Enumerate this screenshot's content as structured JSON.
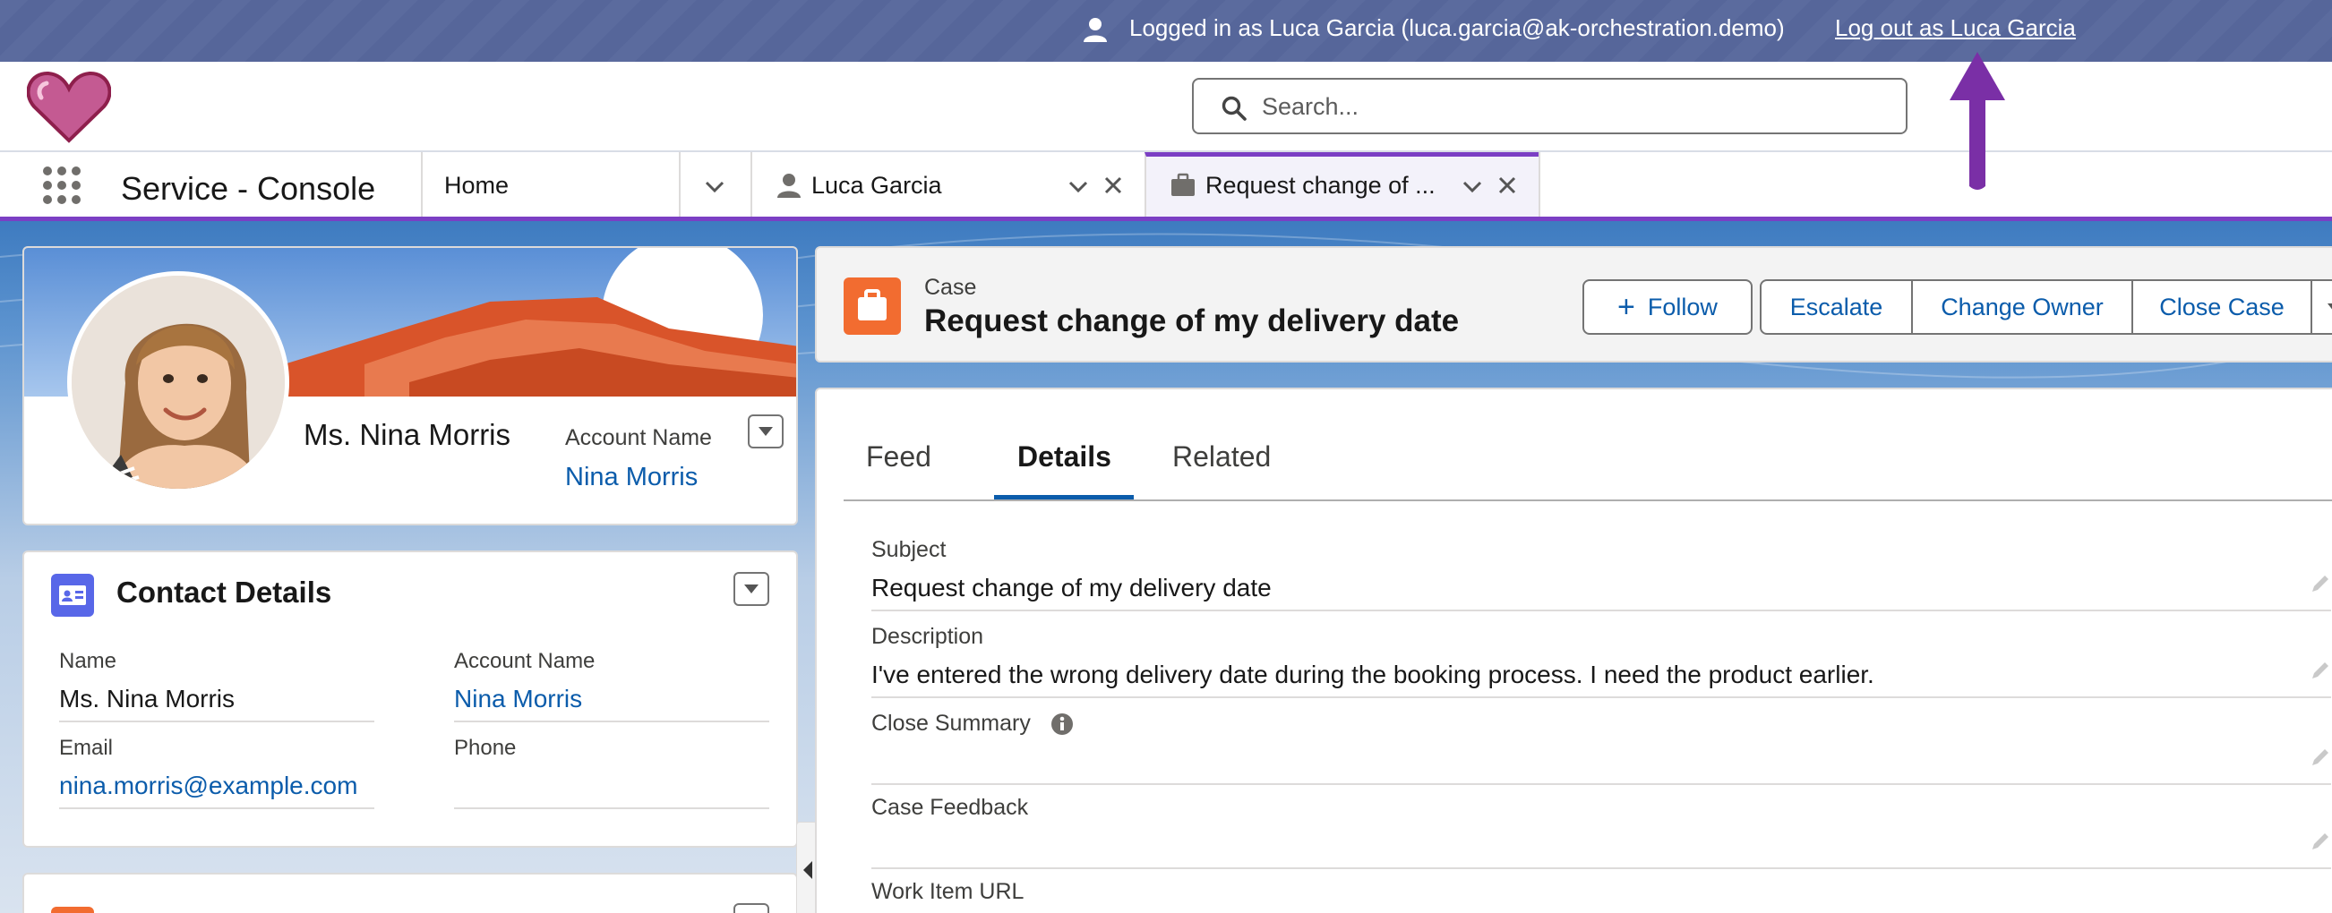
{
  "banner": {
    "logged_in_text": "Logged in as Luca Garcia (luca.garcia@ak-orchestration.demo)",
    "logout_link": "Log out as Luca Garcia"
  },
  "search": {
    "placeholder": "Search..."
  },
  "nav": {
    "app_name": "Service - Console",
    "tabs": [
      {
        "label": "Home"
      },
      {
        "label": "Luca Garcia"
      },
      {
        "label": "Request change of ..."
      }
    ]
  },
  "profile": {
    "name": "Ms. Nina Morris",
    "account_label": "Account Name",
    "account_value": "Nina Morris"
  },
  "contact_details": {
    "title": "Contact Details",
    "fields": [
      {
        "label": "Name",
        "value": "Ms. Nina Morris"
      },
      {
        "label": "Account Name",
        "value": "Nina Morris"
      },
      {
        "label": "Email",
        "value": "nina.morris@example.com"
      },
      {
        "label": "Phone",
        "value": ""
      }
    ]
  },
  "case": {
    "kind": "Case",
    "title": "Request change of my delivery date",
    "buttons": {
      "follow": "Follow",
      "escalate": "Escalate",
      "change_owner": "Change Owner",
      "close_case": "Close Case"
    },
    "tabs": [
      {
        "label": "Feed"
      },
      {
        "label": "Details"
      },
      {
        "label": "Related"
      }
    ],
    "fields": [
      {
        "label": "Subject",
        "value": "Request change of my delivery date"
      },
      {
        "label": "Description",
        "value": "I've entered the wrong delivery date during the booking process. I need the product earlier."
      },
      {
        "label": "Close Summary",
        "value": ""
      },
      {
        "label": "Case Feedback",
        "value": ""
      },
      {
        "label": "Work Item URL",
        "value": ""
      }
    ]
  },
  "colors": {
    "accent_purple": "#7b3fc4",
    "link_blue": "#0b5cab",
    "case_orange": "#f26c30",
    "contact_icon": "#5867e8",
    "banner": "#5b6b9e"
  },
  "icons": {
    "logo": "heart-logo",
    "user": "user-icon",
    "search": "search-icon",
    "launcher": "app-launcher-icon",
    "case": "briefcase-icon",
    "contact_card": "contact-card-icon",
    "info": "info-icon",
    "edit": "pencil-icon"
  }
}
